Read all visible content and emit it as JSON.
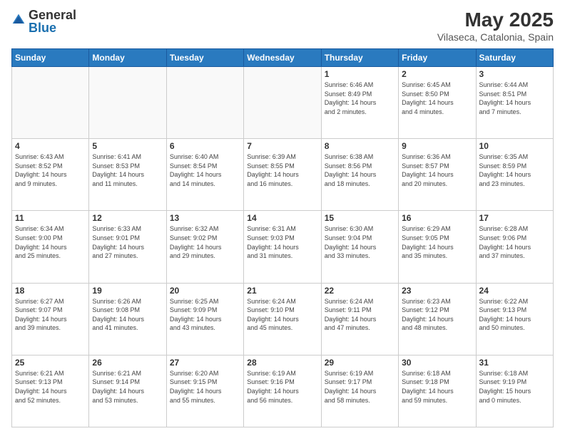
{
  "logo": {
    "general": "General",
    "blue": "Blue"
  },
  "header": {
    "month": "May 2025",
    "location": "Vilaseca, Catalonia, Spain"
  },
  "weekdays": [
    "Sunday",
    "Monday",
    "Tuesday",
    "Wednesday",
    "Thursday",
    "Friday",
    "Saturday"
  ],
  "weeks": [
    [
      {
        "day": "",
        "info": ""
      },
      {
        "day": "",
        "info": ""
      },
      {
        "day": "",
        "info": ""
      },
      {
        "day": "",
        "info": ""
      },
      {
        "day": "1",
        "info": "Sunrise: 6:46 AM\nSunset: 8:49 PM\nDaylight: 14 hours\nand 2 minutes."
      },
      {
        "day": "2",
        "info": "Sunrise: 6:45 AM\nSunset: 8:50 PM\nDaylight: 14 hours\nand 4 minutes."
      },
      {
        "day": "3",
        "info": "Sunrise: 6:44 AM\nSunset: 8:51 PM\nDaylight: 14 hours\nand 7 minutes."
      }
    ],
    [
      {
        "day": "4",
        "info": "Sunrise: 6:43 AM\nSunset: 8:52 PM\nDaylight: 14 hours\nand 9 minutes."
      },
      {
        "day": "5",
        "info": "Sunrise: 6:41 AM\nSunset: 8:53 PM\nDaylight: 14 hours\nand 11 minutes."
      },
      {
        "day": "6",
        "info": "Sunrise: 6:40 AM\nSunset: 8:54 PM\nDaylight: 14 hours\nand 14 minutes."
      },
      {
        "day": "7",
        "info": "Sunrise: 6:39 AM\nSunset: 8:55 PM\nDaylight: 14 hours\nand 16 minutes."
      },
      {
        "day": "8",
        "info": "Sunrise: 6:38 AM\nSunset: 8:56 PM\nDaylight: 14 hours\nand 18 minutes."
      },
      {
        "day": "9",
        "info": "Sunrise: 6:36 AM\nSunset: 8:57 PM\nDaylight: 14 hours\nand 20 minutes."
      },
      {
        "day": "10",
        "info": "Sunrise: 6:35 AM\nSunset: 8:59 PM\nDaylight: 14 hours\nand 23 minutes."
      }
    ],
    [
      {
        "day": "11",
        "info": "Sunrise: 6:34 AM\nSunset: 9:00 PM\nDaylight: 14 hours\nand 25 minutes."
      },
      {
        "day": "12",
        "info": "Sunrise: 6:33 AM\nSunset: 9:01 PM\nDaylight: 14 hours\nand 27 minutes."
      },
      {
        "day": "13",
        "info": "Sunrise: 6:32 AM\nSunset: 9:02 PM\nDaylight: 14 hours\nand 29 minutes."
      },
      {
        "day": "14",
        "info": "Sunrise: 6:31 AM\nSunset: 9:03 PM\nDaylight: 14 hours\nand 31 minutes."
      },
      {
        "day": "15",
        "info": "Sunrise: 6:30 AM\nSunset: 9:04 PM\nDaylight: 14 hours\nand 33 minutes."
      },
      {
        "day": "16",
        "info": "Sunrise: 6:29 AM\nSunset: 9:05 PM\nDaylight: 14 hours\nand 35 minutes."
      },
      {
        "day": "17",
        "info": "Sunrise: 6:28 AM\nSunset: 9:06 PM\nDaylight: 14 hours\nand 37 minutes."
      }
    ],
    [
      {
        "day": "18",
        "info": "Sunrise: 6:27 AM\nSunset: 9:07 PM\nDaylight: 14 hours\nand 39 minutes."
      },
      {
        "day": "19",
        "info": "Sunrise: 6:26 AM\nSunset: 9:08 PM\nDaylight: 14 hours\nand 41 minutes."
      },
      {
        "day": "20",
        "info": "Sunrise: 6:25 AM\nSunset: 9:09 PM\nDaylight: 14 hours\nand 43 minutes."
      },
      {
        "day": "21",
        "info": "Sunrise: 6:24 AM\nSunset: 9:10 PM\nDaylight: 14 hours\nand 45 minutes."
      },
      {
        "day": "22",
        "info": "Sunrise: 6:24 AM\nSunset: 9:11 PM\nDaylight: 14 hours\nand 47 minutes."
      },
      {
        "day": "23",
        "info": "Sunrise: 6:23 AM\nSunset: 9:12 PM\nDaylight: 14 hours\nand 48 minutes."
      },
      {
        "day": "24",
        "info": "Sunrise: 6:22 AM\nSunset: 9:13 PM\nDaylight: 14 hours\nand 50 minutes."
      }
    ],
    [
      {
        "day": "25",
        "info": "Sunrise: 6:21 AM\nSunset: 9:13 PM\nDaylight: 14 hours\nand 52 minutes."
      },
      {
        "day": "26",
        "info": "Sunrise: 6:21 AM\nSunset: 9:14 PM\nDaylight: 14 hours\nand 53 minutes."
      },
      {
        "day": "27",
        "info": "Sunrise: 6:20 AM\nSunset: 9:15 PM\nDaylight: 14 hours\nand 55 minutes."
      },
      {
        "day": "28",
        "info": "Sunrise: 6:19 AM\nSunset: 9:16 PM\nDaylight: 14 hours\nand 56 minutes."
      },
      {
        "day": "29",
        "info": "Sunrise: 6:19 AM\nSunset: 9:17 PM\nDaylight: 14 hours\nand 58 minutes."
      },
      {
        "day": "30",
        "info": "Sunrise: 6:18 AM\nSunset: 9:18 PM\nDaylight: 14 hours\nand 59 minutes."
      },
      {
        "day": "31",
        "info": "Sunrise: 6:18 AM\nSunset: 9:19 PM\nDaylight: 15 hours\nand 0 minutes."
      }
    ]
  ]
}
